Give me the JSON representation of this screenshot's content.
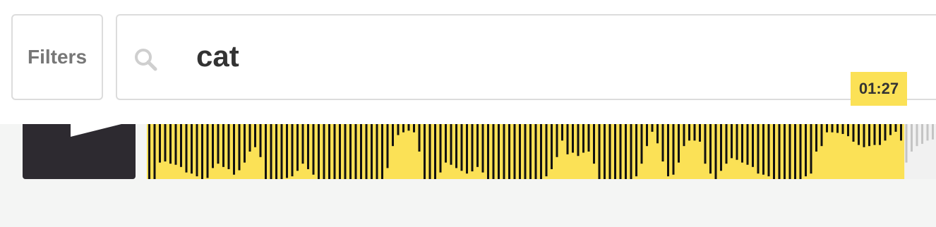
{
  "filters": {
    "label": "Filters"
  },
  "search": {
    "value": "cat",
    "icon": "search-icon"
  },
  "player": {
    "play_icon": "play-icon",
    "current_time": "01:27",
    "progress": 0.96,
    "colors": {
      "played_bg": "#fbe156",
      "played_bar": "#111111",
      "unplayed_bg": "#f1f1f1",
      "unplayed_bar": "#c4c4c4"
    },
    "levels": [
      1.0,
      1.0,
      0.7,
      0.68,
      0.72,
      0.74,
      0.78,
      0.88,
      0.9,
      0.95,
      1.0,
      0.98,
      0.8,
      0.72,
      0.78,
      0.82,
      0.92,
      0.84,
      0.7,
      0.5,
      0.42,
      0.6,
      1.0,
      1.0,
      1.0,
      1.0,
      0.98,
      0.95,
      0.85,
      0.72,
      0.82,
      0.92,
      1.0,
      1.0,
      1.0,
      1.0,
      1.0,
      1.0,
      1.0,
      1.0,
      1.0,
      1.0,
      1.0,
      1.0,
      1.0,
      0.8,
      0.4,
      0.2,
      0.15,
      0.12,
      0.15,
      0.5,
      1.0,
      1.0,
      1.0,
      0.88,
      0.7,
      0.74,
      0.8,
      0.85,
      0.9,
      0.86,
      0.78,
      0.88,
      1.0,
      1.0,
      1.0,
      1.0,
      1.0,
      1.0,
      1.0,
      1.0,
      1.0,
      1.0,
      1.0,
      0.95,
      0.82,
      0.6,
      0.3,
      0.55,
      0.52,
      0.58,
      0.52,
      0.5,
      0.72,
      1.0,
      1.0,
      1.0,
      1.0,
      1.0,
      1.0,
      1.0,
      0.95,
      0.72,
      0.4,
      0.14,
      0.35,
      0.68,
      0.95,
      0.92,
      0.7,
      0.4,
      0.3,
      0.3,
      0.32,
      0.72,
      0.9,
      1.0,
      0.85,
      0.72,
      0.62,
      0.65,
      0.7,
      0.74,
      0.78,
      0.9,
      0.92,
      0.95,
      1.0,
      1.0,
      1.0,
      1.0,
      1.0,
      1.0,
      0.95,
      0.9,
      0.5,
      0.4,
      0.15,
      0.15,
      0.16,
      0.18,
      0.22,
      0.32,
      0.38,
      0.42,
      0.4,
      0.38,
      0.38,
      0.3,
      0.2,
      0.14,
      0.3,
      0.7,
      0.5,
      0.4,
      0.36,
      0.3,
      0.28,
      0.26,
      0.3
    ]
  }
}
